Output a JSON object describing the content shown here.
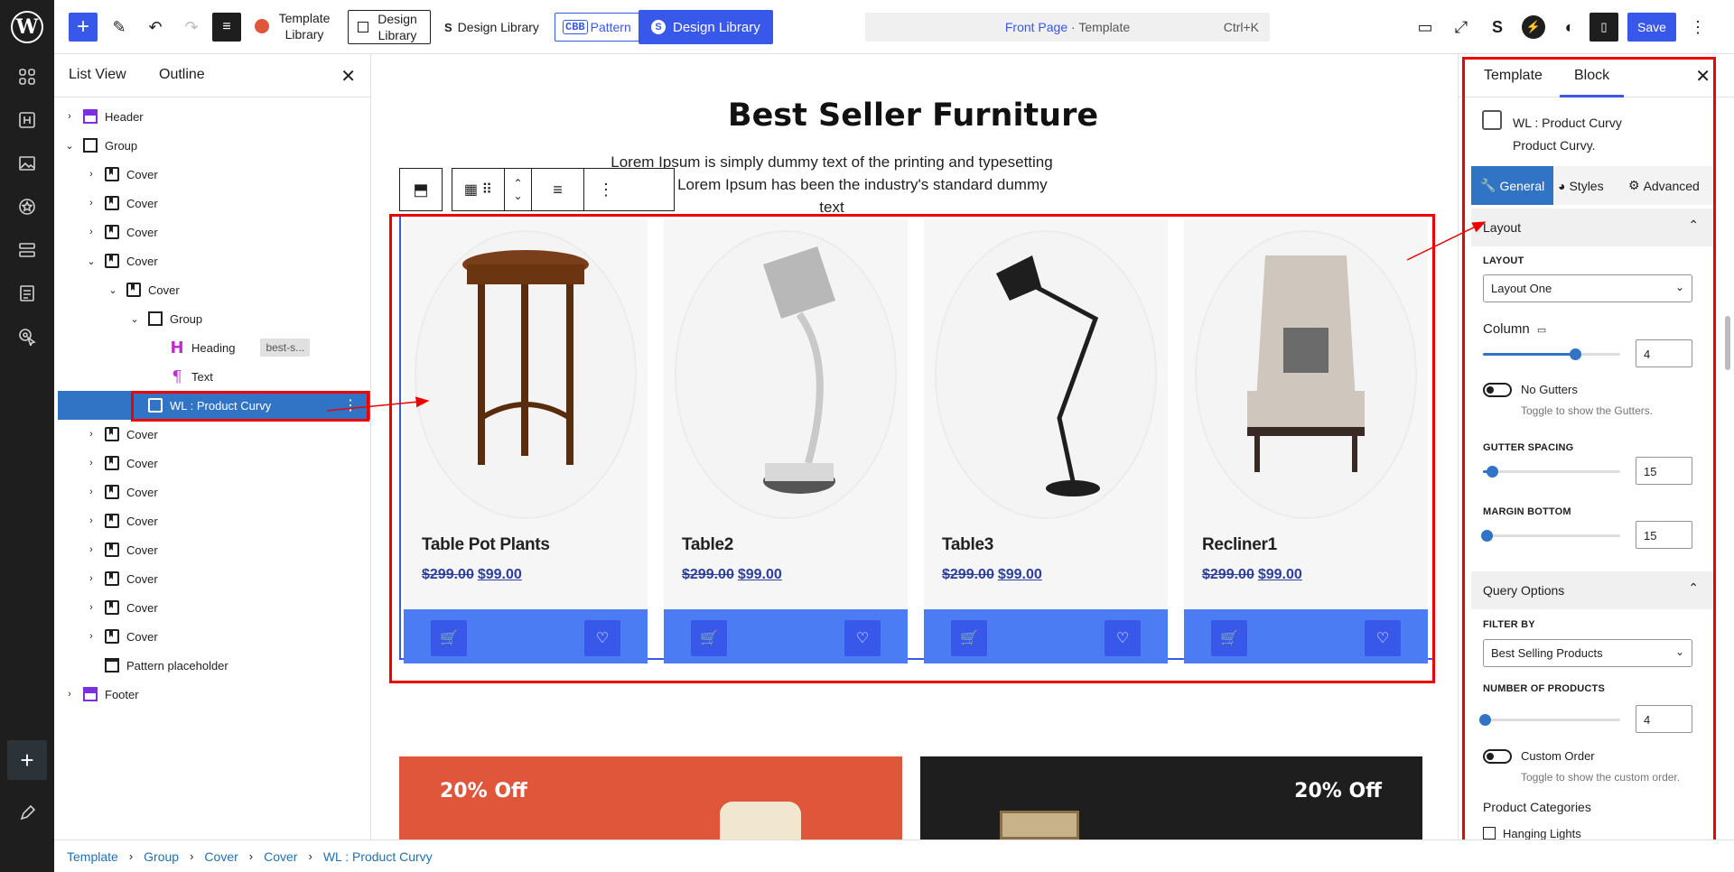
{
  "topbar": {
    "template_library_label": "Template Library",
    "design_library_boxed_label": "Design Library",
    "design_library_label": "Design Library",
    "pattern_label": "Pattern",
    "pattern_prefix": "CBB",
    "design_library_primary_label": "Design Library",
    "document_page": "Front Page",
    "document_sep": " · ",
    "document_type": "Template",
    "shortcut": "Ctrl+K",
    "save_label": "Save"
  },
  "listview": {
    "tab_list": "List View",
    "tab_outline": "Outline",
    "rows": [
      {
        "label": "Header"
      },
      {
        "label": "Group"
      },
      {
        "label": "Cover"
      },
      {
        "label": "Cover"
      },
      {
        "label": "Cover"
      },
      {
        "label": "Cover"
      },
      {
        "label": "Cover"
      },
      {
        "label": "Group"
      },
      {
        "label": "Heading",
        "anchor": "best-s..."
      },
      {
        "label": "Text"
      },
      {
        "label": "WL : Product Curvy"
      },
      {
        "label": "Cover"
      },
      {
        "label": "Cover"
      },
      {
        "label": "Cover"
      },
      {
        "label": "Cover"
      },
      {
        "label": "Cover"
      },
      {
        "label": "Cover"
      },
      {
        "label": "Cover"
      },
      {
        "label": "Cover"
      },
      {
        "label": "Pattern placeholder"
      },
      {
        "label": "Footer"
      }
    ]
  },
  "canvas": {
    "heading": "Best Seller Furniture",
    "subtext": "Lorem Ipsum is simply dummy text of the printing and typesetting industry. Lorem Ipsum has been the industry's standard dummy text",
    "products": [
      {
        "name": "Table Pot Plants",
        "old_price": "$299.00",
        "price": "$99.00"
      },
      {
        "name": "Table2",
        "old_price": "$299.00",
        "price": "$99.00"
      },
      {
        "name": "Table3",
        "old_price": "$299.00",
        "price": "$99.00"
      },
      {
        "name": "Recliner1",
        "old_price": "$299.00",
        "price": "$99.00"
      }
    ],
    "promo_left": "20% Off",
    "promo_right": "20% Off"
  },
  "sidebar": {
    "tab_template": "Template",
    "tab_block": "Block",
    "block_title": "WL : Product Curvy",
    "block_desc": "Product Curvy.",
    "tab_general": "General",
    "tab_styles": "Styles",
    "tab_advanced": "Advanced",
    "layout_section": "Layout",
    "layout_label": "LAYOUT",
    "layout_value": "Layout One",
    "column_label": "Column",
    "column_value": "4",
    "no_gutters_label": "No Gutters",
    "no_gutters_help": "Toggle to show the Gutters.",
    "gutter_label": "GUTTER SPACING",
    "gutter_value": "15",
    "margin_label": "MARGIN BOTTOM",
    "margin_value": "15",
    "query_section": "Query Options",
    "filter_label": "FILTER BY",
    "filter_value": "Best Selling Products",
    "num_label": "NUMBER OF PRODUCTS",
    "num_value": "4",
    "custom_order_label": "Custom Order",
    "custom_order_help": "Toggle to show the custom order.",
    "categories_label": "Product Categories",
    "category_first": "Hanging Lights"
  },
  "breadcrumb": [
    "Template",
    "Group",
    "Cover",
    "Cover",
    "WL : Product Curvy"
  ],
  "colors": {
    "accent": "#3858e9",
    "selection": "#3174c5",
    "annotation": "#e00000",
    "promo_left": "#e0563a",
    "promo_right": "#1e1e1e"
  }
}
